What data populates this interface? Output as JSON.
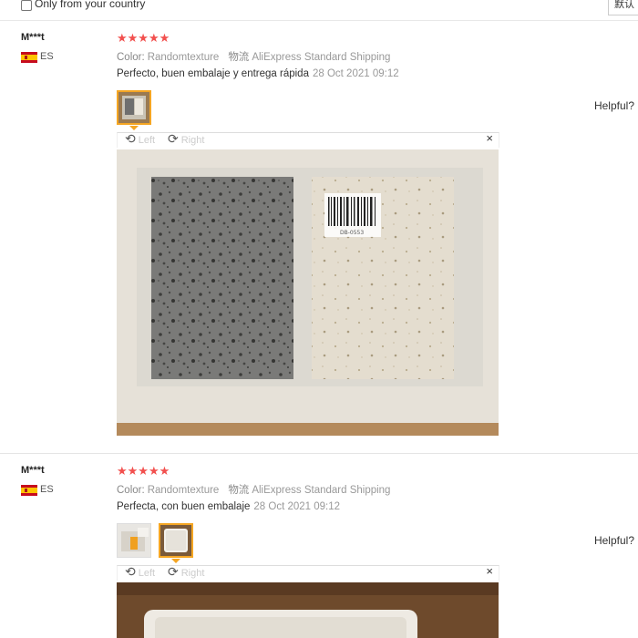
{
  "filter": {
    "only_country_label": "Only from your country",
    "lang_label": "默认"
  },
  "reviews": [
    {
      "user": "M***t",
      "country": "ES",
      "stars": "★★★★★",
      "color_label": "Color:",
      "color_value": "Randomtexture",
      "ship_label": "物流",
      "ship_value": "AliExpress Standard Shipping",
      "text": "Perfecto, buen embalaje y entrega rápida",
      "date": "28 Oct 2021 09:12",
      "helpful": "Helpful?",
      "viewer": {
        "left": "Left",
        "right": "Right",
        "close": "×"
      }
    },
    {
      "user": "M***t",
      "country": "ES",
      "stars": "★★★★★",
      "color_label": "Color:",
      "color_value": "Randomtexture",
      "ship_label": "物流",
      "ship_value": "AliExpress Standard Shipping",
      "text": "Perfecta, con buen embalaje",
      "date": "28 Oct 2021 09:12",
      "helpful": "Helpful?",
      "viewer": {
        "left": "Left",
        "right": "Right",
        "close": "×"
      }
    }
  ],
  "photo_barcode_text": "DB-0553",
  "icons": {
    "rotate_left": "rotate-left-icon",
    "rotate_right": "rotate-right-icon",
    "close": "close-icon"
  },
  "colors": {
    "stars": "#f2504e",
    "active_thumb": "#f5a623"
  }
}
